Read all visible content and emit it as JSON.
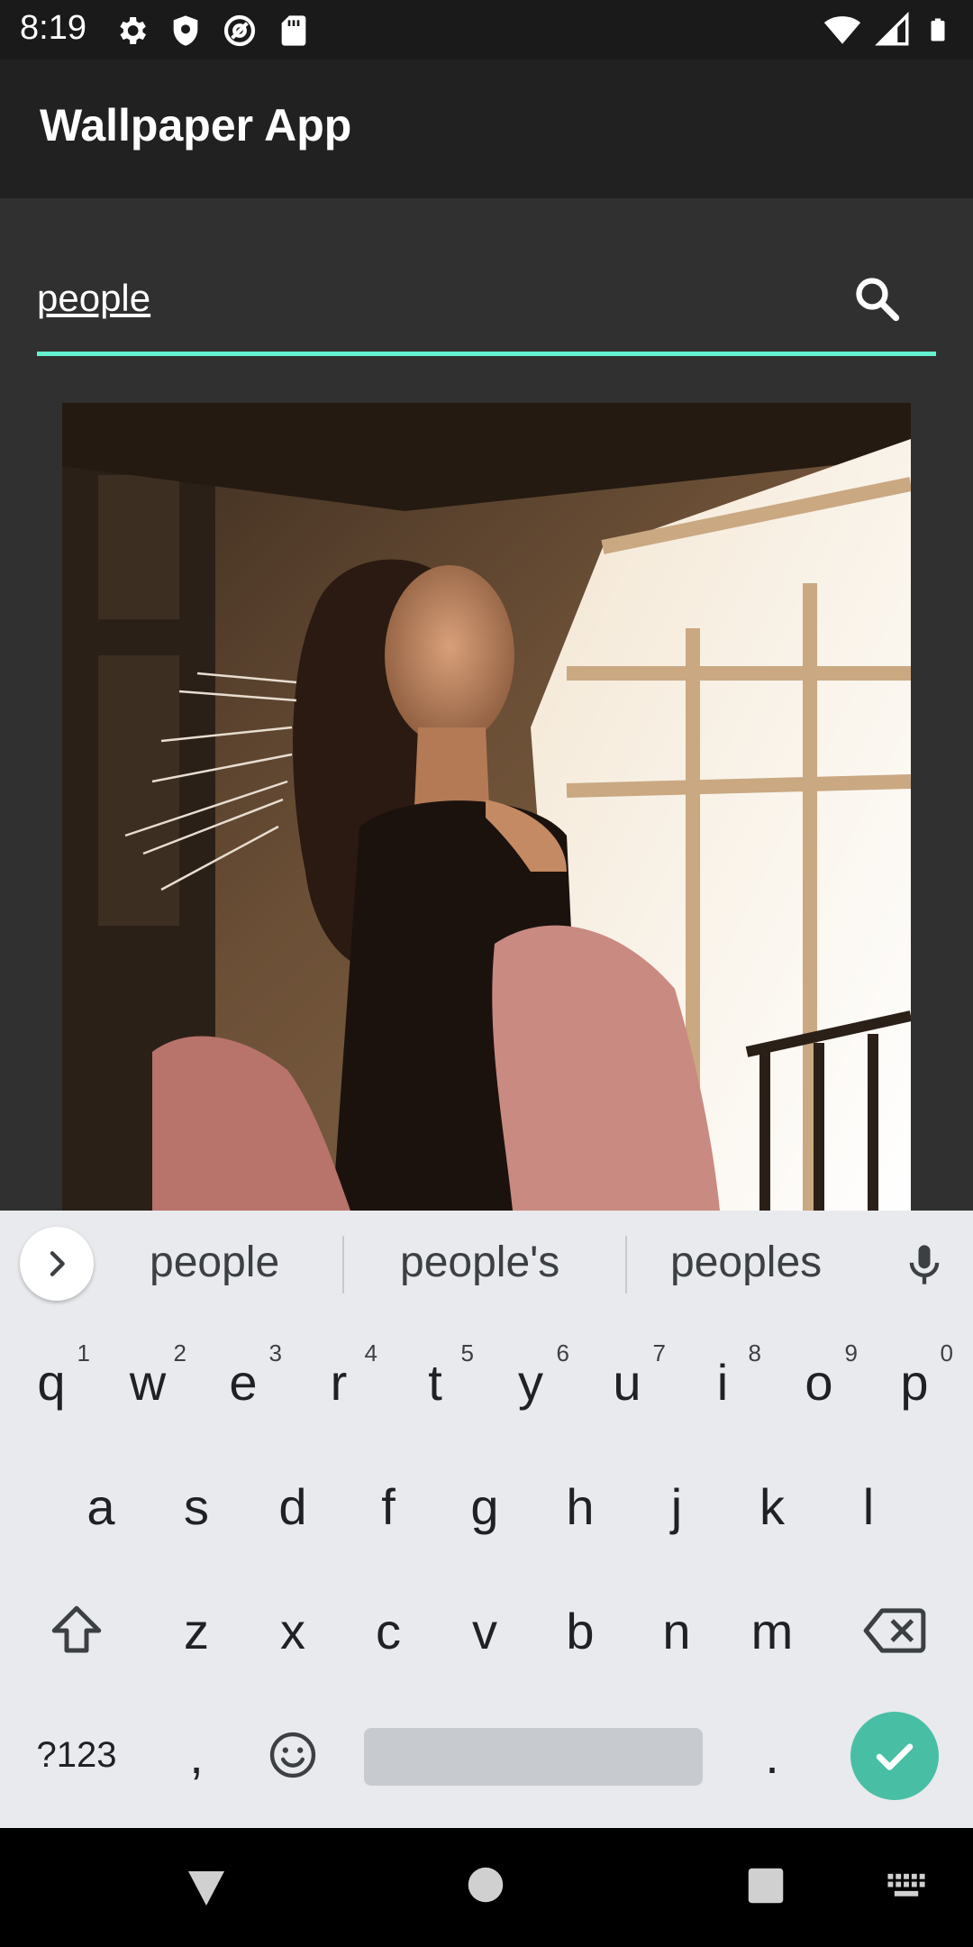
{
  "status_bar": {
    "time": "8:19",
    "left_icons": [
      "settings-icon",
      "shield-icon",
      "at-sign-icon",
      "sd-card-icon"
    ],
    "right_icons": [
      "wifi-icon",
      "signal-icon",
      "battery-icon"
    ]
  },
  "app_bar": {
    "title": "Wallpaper App"
  },
  "search": {
    "value": "people",
    "accent_color": "#64f2d0"
  },
  "results": [
    {
      "alt": "Woman in pink fur jacket near window"
    }
  ],
  "keyboard": {
    "suggestions": [
      "people",
      "people's",
      "peoples"
    ],
    "row1": [
      {
        "k": "q",
        "n": "1"
      },
      {
        "k": "w",
        "n": "2"
      },
      {
        "k": "e",
        "n": "3"
      },
      {
        "k": "r",
        "n": "4"
      },
      {
        "k": "t",
        "n": "5"
      },
      {
        "k": "y",
        "n": "6"
      },
      {
        "k": "u",
        "n": "7"
      },
      {
        "k": "i",
        "n": "8"
      },
      {
        "k": "o",
        "n": "9"
      },
      {
        "k": "p",
        "n": "0"
      }
    ],
    "row2": [
      "a",
      "s",
      "d",
      "f",
      "g",
      "h",
      "j",
      "k",
      "l"
    ],
    "row3": [
      "z",
      "x",
      "c",
      "v",
      "b",
      "n",
      "m"
    ],
    "symbols_label": "?123",
    "comma": ",",
    "period": ".",
    "accent_color": "#48bfa5"
  }
}
